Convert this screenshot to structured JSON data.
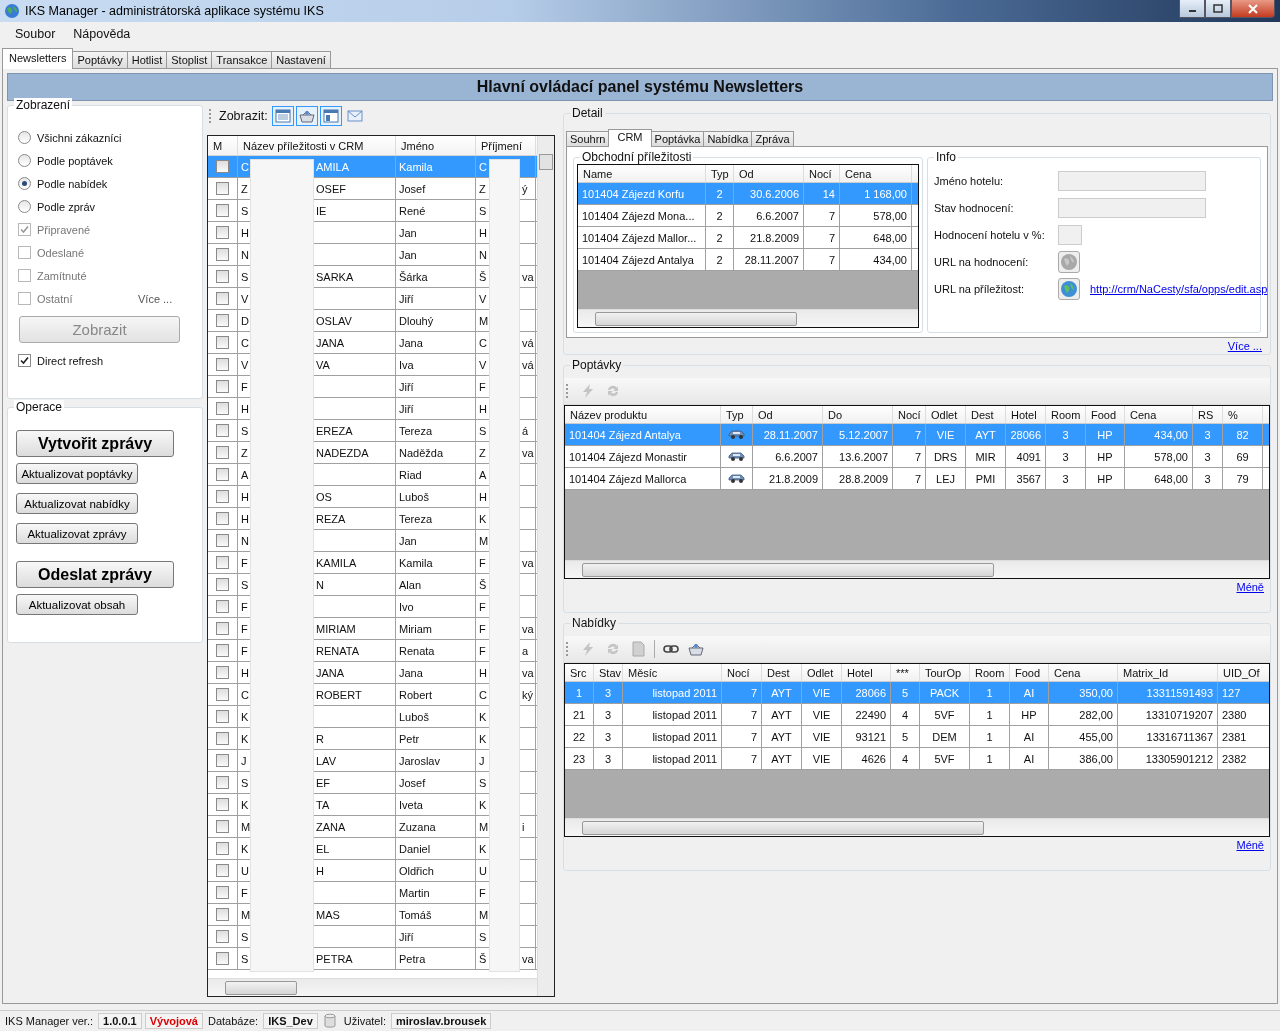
{
  "window": {
    "title": "IKS Manager - administrátorská aplikace systému IKS"
  },
  "menu": [
    "Soubor",
    "Nápověda"
  ],
  "tabs": [
    {
      "label": "Newsletters",
      "selected": true
    },
    {
      "label": "Poptávky",
      "selected": false
    },
    {
      "label": "Hotlist",
      "selected": false
    },
    {
      "label": "Stoplist",
      "selected": false
    },
    {
      "label": "Transakce",
      "selected": false
    },
    {
      "label": "Nastavení",
      "selected": false
    }
  ],
  "banner": "Hlavní ovládací panel systému Newsletters",
  "view_group": {
    "title": "Zobrazení",
    "options": [
      {
        "kind": "radio",
        "label": "Všichni zákazníci",
        "selected": false,
        "disabled": false
      },
      {
        "kind": "radio",
        "label": "Podle poptávek",
        "selected": false,
        "disabled": false
      },
      {
        "kind": "radio",
        "label": "Podle nabídek",
        "selected": true,
        "disabled": false
      },
      {
        "kind": "radio",
        "label": "Podle zpráv",
        "selected": false,
        "disabled": false
      },
      {
        "kind": "checkbox",
        "label": "Připravené",
        "checked": true,
        "disabled": true
      },
      {
        "kind": "checkbox",
        "label": "Odeslané",
        "checked": false,
        "disabled": true
      },
      {
        "kind": "checkbox",
        "label": "Zamítnuté",
        "checked": false,
        "disabled": true
      },
      {
        "kind": "checkbox",
        "label": "Ostatní",
        "checked": false,
        "disabled": true
      }
    ],
    "more_link": "Více ...",
    "show_button": {
      "label": "Zobrazit",
      "disabled": true
    },
    "direct_refresh": {
      "label": "Direct refresh",
      "checked": true
    }
  },
  "operations": {
    "title": "Operace",
    "buttons": [
      {
        "label": "Vytvořit zprávy",
        "kind": "primary"
      },
      {
        "label": "Aktualizovat poptávky",
        "kind": "small"
      },
      {
        "label": "Aktualizovat nabídky",
        "kind": "small"
      },
      {
        "label": "Aktualizovat zprávy",
        "kind": "small"
      },
      {
        "label": "Odeslat zprávy",
        "kind": "primary"
      },
      {
        "label": "Aktualizovat obsah",
        "kind": "small"
      }
    ]
  },
  "view_toolbar": {
    "label": "Zobrazit:",
    "buttons": [
      {
        "kind": "table",
        "selected": true
      },
      {
        "kind": "basket",
        "selected": true
      },
      {
        "kind": "layout",
        "selected": true
      },
      {
        "kind": "mail",
        "selected": false
      }
    ]
  },
  "opportunities": {
    "columns": [
      "M",
      "Název příležitosti v CRM",
      "Jméno",
      "Příjmení"
    ],
    "rows": [
      {
        "name_start": "C",
        "name_end": "AMILA",
        "first": "Kamila",
        "last_start": "C",
        "checked": false,
        "selected": true
      },
      {
        "name_start": "Z",
        "name_end": "OSEF",
        "first": "Josef",
        "last_start": "Z",
        "last_end": "ý",
        "checked": false,
        "selected": false
      },
      {
        "name_start": "S",
        "name_end": "IE",
        "first": "René",
        "last_start": "S",
        "checked": false,
        "selected": false
      },
      {
        "name_start": "H",
        "first": "Jan",
        "last_start": "H",
        "checked": false,
        "selected": false
      },
      {
        "name_start": "N",
        "first": "Jan",
        "last_start": "N",
        "checked": false,
        "selected": false
      },
      {
        "name_start": "S",
        "name_end": "SARKA",
        "first": "Šárka",
        "last_start": "Š",
        "last_end": "va",
        "checked": false,
        "selected": false
      },
      {
        "name_start": "V",
        "first": "Jiří",
        "last_start": "V",
        "checked": false,
        "selected": false
      },
      {
        "name_start": "D",
        "name_end": "OSLAV",
        "first": "Dlouhý",
        "last_start": "M",
        "checked": false,
        "selected": false
      },
      {
        "name_start": "C",
        "name_end": "JANA",
        "first": "Jana",
        "last_start": "C",
        "last_end": "vá",
        "checked": false,
        "selected": false
      },
      {
        "name_start": "V",
        "name_end": "VA",
        "first": "Iva",
        "last_start": "V",
        "last_end": "vá",
        "checked": false,
        "selected": false
      },
      {
        "name_start": "F",
        "first": "Jiří",
        "last_start": "F",
        "checked": false,
        "selected": false
      },
      {
        "name_start": "H",
        "first": "Jiří",
        "last_start": "H",
        "checked": false,
        "selected": false
      },
      {
        "name_start": "S",
        "name_end": "EREZA",
        "first": "Tereza",
        "last_start": "S",
        "last_end": "á",
        "checked": false,
        "selected": false
      },
      {
        "name_start": "Z",
        "name_end": "NADEZDA",
        "first": "Naděžda",
        "last_start": "Z",
        "last_end": "va",
        "checked": false,
        "selected": false
      },
      {
        "name_start": "A",
        "first": "Riad",
        "last_start": "A",
        "checked": false,
        "selected": false
      },
      {
        "name_start": "H",
        "name_end": "OS",
        "first": "Luboš",
        "last_start": "H",
        "checked": false,
        "selected": false
      },
      {
        "name_start": "H",
        "name_end": "REZA",
        "first": "Tereza",
        "last_start": "K",
        "checked": false,
        "selected": false
      },
      {
        "name_start": "N",
        "first": "Jan",
        "last_start": "M",
        "checked": false,
        "selected": false
      },
      {
        "name_start": "F",
        "name_end": "KAMILA",
        "first": "Kamila",
        "last_start": "F",
        "last_end": "va",
        "checked": false,
        "selected": false
      },
      {
        "name_start": "S",
        "name_end": "N",
        "first": "Alan",
        "last_start": "Š",
        "checked": false,
        "selected": false
      },
      {
        "name_start": "F",
        "first": "Ivo",
        "last_start": "F",
        "checked": false,
        "selected": false
      },
      {
        "name_start": "F",
        "name_end": "MIRIAM",
        "first": "Miriam",
        "last_start": "F",
        "last_end": "va",
        "checked": false,
        "selected": false
      },
      {
        "name_start": "F",
        "name_end": "RENATA",
        "first": "Renata",
        "last_start": "F",
        "last_end": "a",
        "checked": false,
        "selected": false
      },
      {
        "name_start": "H",
        "name_end": "JANA",
        "first": "Jana",
        "last_start": "H",
        "last_end": "va",
        "checked": false,
        "selected": false
      },
      {
        "name_start": "C",
        "name_end": "ROBERT",
        "first": "Robert",
        "last_start": "C",
        "last_end": "ký",
        "checked": false,
        "selected": false
      },
      {
        "name_start": "K",
        "first": "Luboš",
        "last_start": "K",
        "checked": false,
        "selected": false
      },
      {
        "name_start": "K",
        "name_end": "R",
        "first": "Petr",
        "last_start": "K",
        "checked": false,
        "selected": false
      },
      {
        "name_start": "J",
        "name_end": "LAV",
        "first": "Jaroslav",
        "last_start": "J",
        "checked": false,
        "selected": false
      },
      {
        "name_start": "S",
        "name_end": "EF",
        "first": "Josef",
        "last_start": "S",
        "checked": false,
        "selected": false
      },
      {
        "name_start": "K",
        "name_end": "TA",
        "first": "Iveta",
        "last_start": "K",
        "checked": false,
        "selected": false
      },
      {
        "name_start": "M",
        "name_end": "ZANA",
        "first": "Zuzana",
        "last_start": "M",
        "last_end": "i",
        "checked": false,
        "selected": false
      },
      {
        "name_start": "K",
        "name_end": "EL",
        "first": "Daniel",
        "last_start": "K",
        "checked": false,
        "selected": false
      },
      {
        "name_start": "U",
        "name_end": "H",
        "first": "Oldřich",
        "last_start": "U",
        "checked": false,
        "selected": false
      },
      {
        "name_start": "F",
        "first": "Martin",
        "last_start": "F",
        "checked": false,
        "selected": false
      },
      {
        "name_start": "M",
        "name_end": "MAS",
        "first": "Tomáš",
        "last_start": "M",
        "checked": false,
        "selected": false
      },
      {
        "name_start": "S",
        "first": "Jiří",
        "last_start": "S",
        "checked": false,
        "selected": false
      },
      {
        "name_start": "S",
        "name_end": "PETRA",
        "first": "Petra",
        "last_start": "Š",
        "last_end": "va",
        "checked": false,
        "selected": false
      }
    ]
  },
  "detail": {
    "title": "Detail",
    "tabs": [
      {
        "label": "Souhrn",
        "selected": false
      },
      {
        "label": "CRM",
        "selected": true
      },
      {
        "label": "Poptávka",
        "selected": false
      },
      {
        "label": "Nabídka",
        "selected": false
      },
      {
        "label": "Zpráva",
        "selected": false
      }
    ],
    "crm": {
      "title": "Obchodní příležitosti",
      "columns": [
        "Name",
        "Typ",
        "Od",
        "Nocí",
        "Cena"
      ],
      "rows": [
        {
          "selected": true,
          "cells": [
            "101404 Zájezd Korfu",
            "2",
            "30.6.2006",
            "14",
            "1 168,00"
          ]
        },
        {
          "selected": false,
          "cells": [
            "101404 Zájezd Mona...",
            "2",
            "6.6.2007",
            "7",
            "578,00"
          ]
        },
        {
          "selected": false,
          "cells": [
            "101404 Zájezd Mallor...",
            "2",
            "21.8.2009",
            "7",
            "648,00"
          ]
        },
        {
          "selected": false,
          "cells": [
            "101404 Zájezd Antalya",
            "2",
            "28.11.2007",
            "7",
            "434,00"
          ]
        }
      ]
    },
    "info": {
      "title": "Info",
      "fields": [
        {
          "kind": "text",
          "label": "Jméno hotelu:"
        },
        {
          "kind": "short",
          "label": "Stav hodnocení:"
        },
        {
          "kind": "tiny",
          "label": "Hodnocení hotelu v %:"
        },
        {
          "kind": "button",
          "label": "URL na hodnocení:",
          "disabled": true
        },
        {
          "kind": "button",
          "label": "URL na příležitost:",
          "disabled": false,
          "url": "http://crm/NaCesty/sfa/opps/edit.asp"
        }
      ]
    },
    "more_link": "Více ..."
  },
  "inquiries": {
    "title": "Poptávky",
    "tools": [
      {
        "kind": "lightning",
        "disabled": true
      },
      {
        "kind": "refresh",
        "disabled": true
      }
    ],
    "columns": [
      "Název produktu",
      "Typ",
      "Od",
      "Do",
      "Nocí",
      "Odlet",
      "Dest",
      "Hotel",
      "Room",
      "Food",
      "Cena",
      "RS",
      "%"
    ],
    "rows": [
      {
        "selected": true,
        "cells": [
          "101404 Zájezd Antalya",
          {
            "kind": "car"
          },
          "28.11.2007",
          "5.12.2007",
          "7",
          "VIE",
          "AYT",
          "28066",
          "3",
          "HP",
          "434,00",
          "3",
          "82"
        ]
      },
      {
        "selected": false,
        "cells": [
          "101404 Zájezd Monastir",
          {
            "kind": "car"
          },
          "6.6.2007",
          "13.6.2007",
          "7",
          "DRS",
          "MIR",
          "4091",
          "3",
          "HP",
          "578,00",
          "3",
          "69"
        ]
      },
      {
        "selected": false,
        "cells": [
          "101404 Zájezd Mallorca",
          {
            "kind": "car"
          },
          "21.8.2009",
          "28.8.2009",
          "7",
          "LEJ",
          "PMI",
          "3567",
          "3",
          "HP",
          "648,00",
          "3",
          "79"
        ]
      }
    ],
    "less_link": "Méně"
  },
  "offers": {
    "title": "Nabídky",
    "tools": [
      {
        "kind": "lightning",
        "disabled": true
      },
      {
        "kind": "refresh",
        "disabled": true
      },
      {
        "kind": "document",
        "disabled": true
      },
      {
        "kind": "link",
        "disabled": false
      },
      {
        "kind": "basket",
        "disabled": false
      }
    ],
    "columns": [
      "Src",
      "Stav",
      "Měsíc",
      "Nocí",
      "Dest",
      "Odlet",
      "Hotel",
      "***",
      "TourOp",
      "Room",
      "Food",
      "Cena",
      "Matrix_Id",
      "UID_Of"
    ],
    "rows": [
      {
        "selected": true,
        "cells": [
          "1",
          "3",
          "listopad 2011",
          "7",
          "AYT",
          "VIE",
          "28066",
          "5",
          "PACK",
          "1",
          "AI",
          "350,00",
          "13311591493",
          "127"
        ]
      },
      {
        "selected": false,
        "cells": [
          "21",
          "3",
          "listopad 2011",
          "7",
          "AYT",
          "VIE",
          "22490",
          "4",
          "5VF",
          "1",
          "HP",
          "282,00",
          "13310719207",
          "2380"
        ]
      },
      {
        "selected": false,
        "cells": [
          "22",
          "3",
          "listopad 2011",
          "7",
          "AYT",
          "VIE",
          "93121",
          "5",
          "DEM",
          "1",
          "AI",
          "455,00",
          "13316711367",
          "2381"
        ]
      },
      {
        "selected": false,
        "cells": [
          "23",
          "3",
          "listopad 2011",
          "7",
          "AYT",
          "VIE",
          "4626",
          "4",
          "5VF",
          "1",
          "AI",
          "386,00",
          "13305901212",
          "2382"
        ]
      }
    ],
    "less_link": "Méně"
  },
  "status_bar": {
    "version_label": "IKS Manager ver.:",
    "version": "1.0.0.1",
    "mode": "Vývojová",
    "db_label": "Databáze:",
    "db": "IKS_Dev",
    "user_label": "Uživatel:",
    "user": "miroslav.brousek"
  }
}
